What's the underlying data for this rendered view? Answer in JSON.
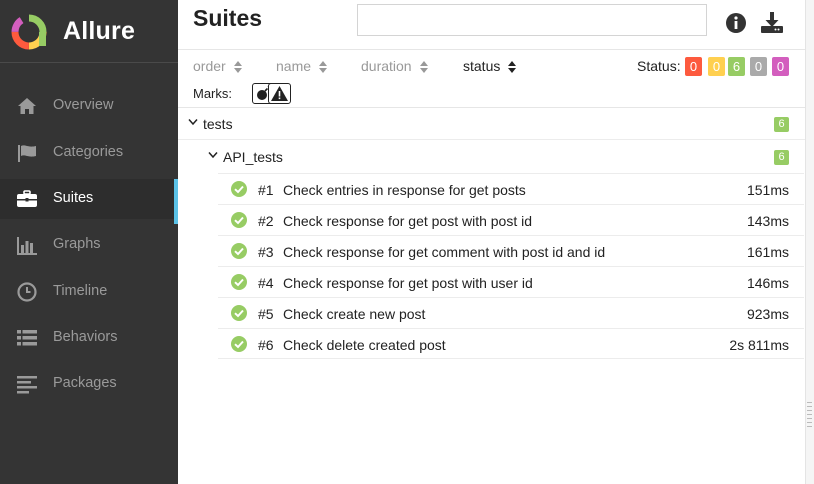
{
  "app": {
    "name": "Allure"
  },
  "sidebar": {
    "items": [
      {
        "label": "Overview",
        "icon": "home-icon"
      },
      {
        "label": "Categories",
        "icon": "flag-icon"
      },
      {
        "label": "Suites",
        "icon": "briefcase-icon",
        "active": true
      },
      {
        "label": "Graphs",
        "icon": "bar-chart-icon"
      },
      {
        "label": "Timeline",
        "icon": "clock-icon"
      },
      {
        "label": "Behaviors",
        "icon": "list-icon"
      },
      {
        "label": "Packages",
        "icon": "align-left-icon"
      }
    ]
  },
  "header": {
    "title": "Suites",
    "search": {
      "value": "",
      "placeholder": ""
    }
  },
  "sorting": {
    "columns": [
      "order",
      "name",
      "duration",
      "status"
    ],
    "selected": "status"
  },
  "status_filter": {
    "label": "Status:",
    "counts": [
      {
        "value": "0",
        "color": "#fd5a3e"
      },
      {
        "value": "0",
        "color": "#ffd050"
      },
      {
        "value": "6",
        "color": "#97cc64"
      },
      {
        "value": "0",
        "color": "#aaaaaa"
      },
      {
        "value": "0",
        "color": "#d35ebe"
      }
    ]
  },
  "marks": {
    "label": "Marks:"
  },
  "tree": {
    "suite": {
      "name": "tests",
      "count": "6"
    },
    "subsuite": {
      "name": "API_tests",
      "count": "6"
    },
    "tests": [
      {
        "num": "#1",
        "name": "Check entries in response for get posts",
        "duration": "151ms"
      },
      {
        "num": "#2",
        "name": "Check response for get post with post id",
        "duration": "143ms"
      },
      {
        "num": "#3",
        "name": "Check response for get comment with post id and id",
        "duration": "161ms"
      },
      {
        "num": "#4",
        "name": "Check response for get post with user id",
        "duration": "146ms"
      },
      {
        "num": "#5",
        "name": "Check create new post",
        "duration": "923ms"
      },
      {
        "num": "#6",
        "name": "Check delete created post",
        "duration": "2s 811ms"
      }
    ]
  },
  "colors": {
    "accent": "#5bc2e7",
    "passed": "#97cc64",
    "sidebar_bg": "#343434"
  }
}
